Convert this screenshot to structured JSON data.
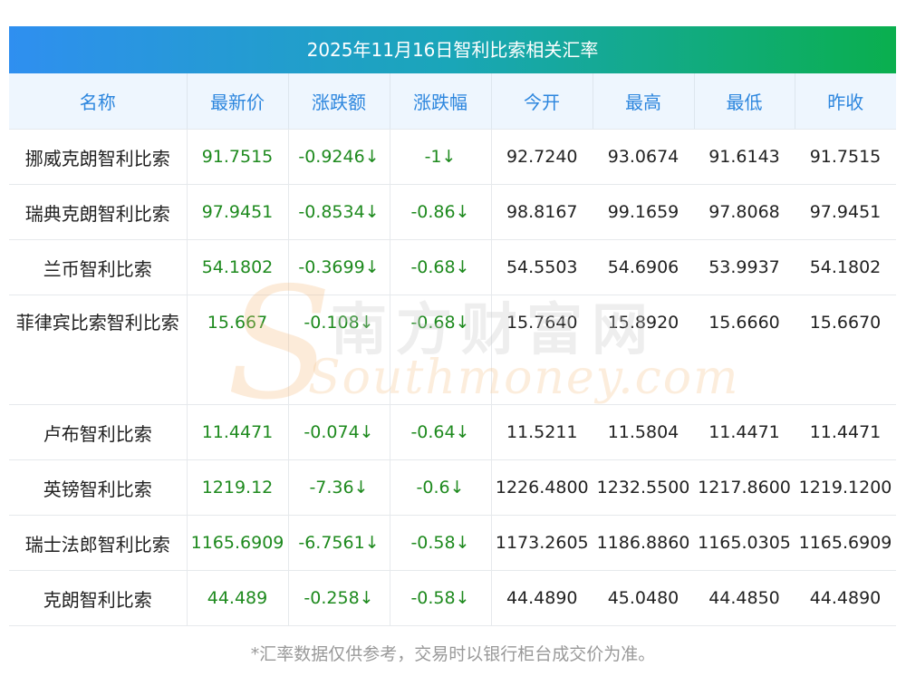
{
  "title": "2025年11月16日智利比索相关汇率",
  "columns": [
    "名称",
    "最新价",
    "涨跌额",
    "涨跌幅",
    "今开",
    "最高",
    "最低",
    "昨收"
  ],
  "rows": [
    {
      "name": "挪威克朗智利比索",
      "latest": "91.7515",
      "change": "-0.9246↓",
      "pct": "-1↓",
      "open": "92.7240",
      "high": "93.0674",
      "low": "91.6143",
      "prev": "91.7515"
    },
    {
      "name": "瑞典克朗智利比索",
      "latest": "97.9451",
      "change": "-0.8534↓",
      "pct": "-0.86↓",
      "open": "98.8167",
      "high": "99.1659",
      "low": "97.8068",
      "prev": "97.9451"
    },
    {
      "name": "兰币智利比索",
      "latest": "54.1802",
      "change": "-0.3699↓",
      "pct": "-0.68↓",
      "open": "54.5503",
      "high": "54.6906",
      "low": "53.9937",
      "prev": "54.1802"
    },
    {
      "name": "菲律宾比索智利比索",
      "latest": "15.667",
      "change": "-0.108↓",
      "pct": "-0.68↓",
      "open": "15.7640",
      "high": "15.8920",
      "low": "15.6660",
      "prev": "15.6670"
    },
    {
      "name": "卢布智利比索",
      "latest": "11.4471",
      "change": "-0.074↓",
      "pct": "-0.64↓",
      "open": "11.5211",
      "high": "11.5804",
      "low": "11.4471",
      "prev": "11.4471"
    },
    {
      "name": "英镑智利比索",
      "latest": "1219.12",
      "change": "-7.36↓",
      "pct": "-0.6↓",
      "open": "1226.4800",
      "high": "1232.5500",
      "low": "1217.8600",
      "prev": "1219.1200"
    },
    {
      "name": "瑞士法郎智利比索",
      "latest": "1165.6909",
      "change": "-6.7561↓",
      "pct": "-0.58↓",
      "open": "1173.2605",
      "high": "1186.8860",
      "low": "1165.0305",
      "prev": "1165.6909"
    },
    {
      "name": "克朗智利比索",
      "latest": "44.489",
      "change": "-0.258↓",
      "pct": "-0.58↓",
      "open": "44.4890",
      "high": "45.0480",
      "low": "44.4850",
      "prev": "44.4890"
    }
  ],
  "watermark": {
    "cn": "南方财富网",
    "en": "Southmoney.com"
  },
  "footnote": "*汇率数据仅供参考，交易时以银行柜台成交价为准。",
  "colors": {
    "header_text": "#2c86de",
    "header_bg": "#eef6fe",
    "change_text": "#1e8a1e",
    "title_gradient": [
      "#2f8ff0",
      "#0aaf4e"
    ]
  }
}
